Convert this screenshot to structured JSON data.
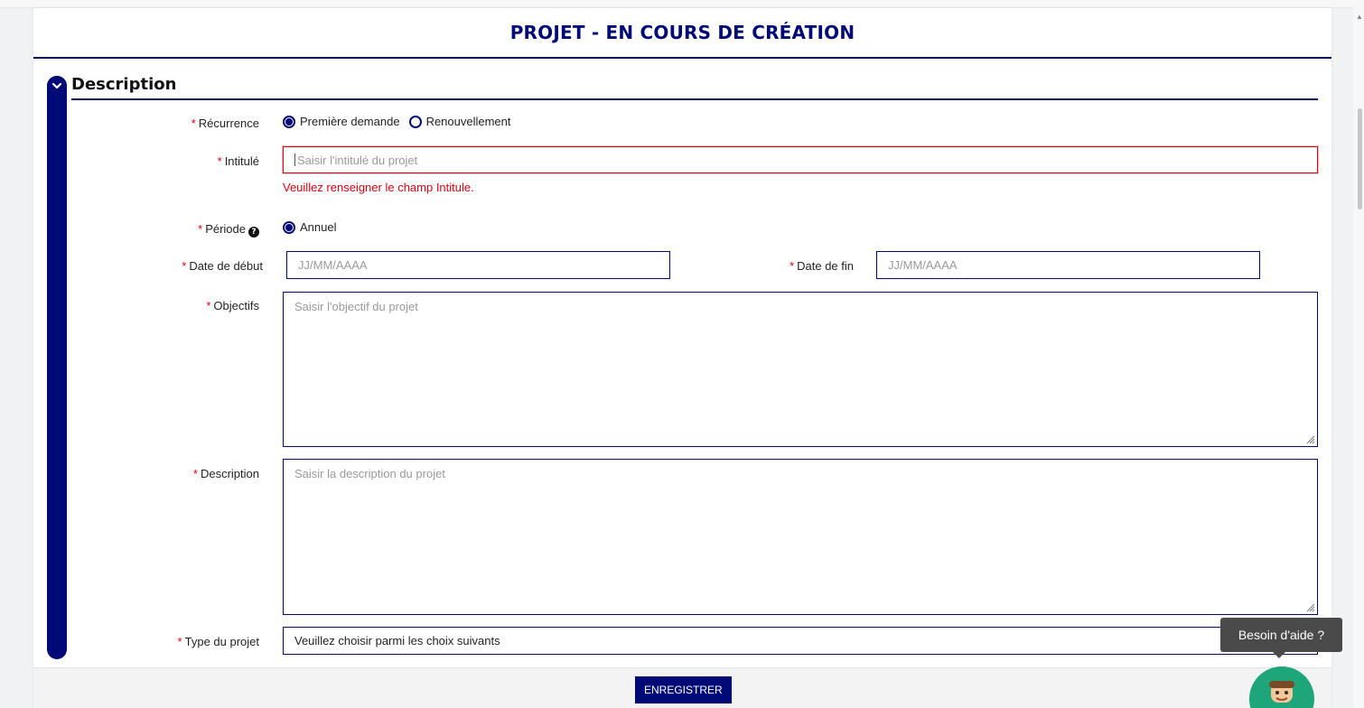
{
  "page": {
    "title": "PROJET - EN COURS DE CRÉATION"
  },
  "section": {
    "title": "Description",
    "toggle_icon": "chevron-down-icon"
  },
  "form": {
    "required_marker": "*",
    "recurrence": {
      "label": "Récurrence",
      "options": [
        "Première demande",
        "Renouvellement"
      ],
      "selected": "Première demande"
    },
    "intitule": {
      "label": "Intitulé",
      "placeholder": "Saisir l'intitulé du projet",
      "value": "",
      "error": "Veuillez renseigner le champ Intitule."
    },
    "periode": {
      "label": "Période",
      "help_icon": "question-circle-icon",
      "options": [
        "Annuel"
      ],
      "selected": "Annuel"
    },
    "date_debut": {
      "label": "Date de début",
      "placeholder": "JJ/MM/AAAA"
    },
    "date_fin": {
      "label": "Date de fin",
      "placeholder": "JJ/MM/AAAA"
    },
    "objectifs": {
      "label": "Objectifs",
      "placeholder": "Saisir l'objectif du projet"
    },
    "description": {
      "label": "Description",
      "placeholder": "Saisir la description du projet"
    },
    "type_projet": {
      "label": "Type du projet",
      "selected": "Veuillez choisir parmi les choix suivants"
    }
  },
  "footer": {
    "save_label": "ENREGISTRER"
  },
  "help": {
    "tooltip": "Besoin d'aide ?"
  },
  "colors": {
    "primary": "#000a76",
    "error": "#e1000f",
    "help_bubble": "#1ea57a"
  }
}
